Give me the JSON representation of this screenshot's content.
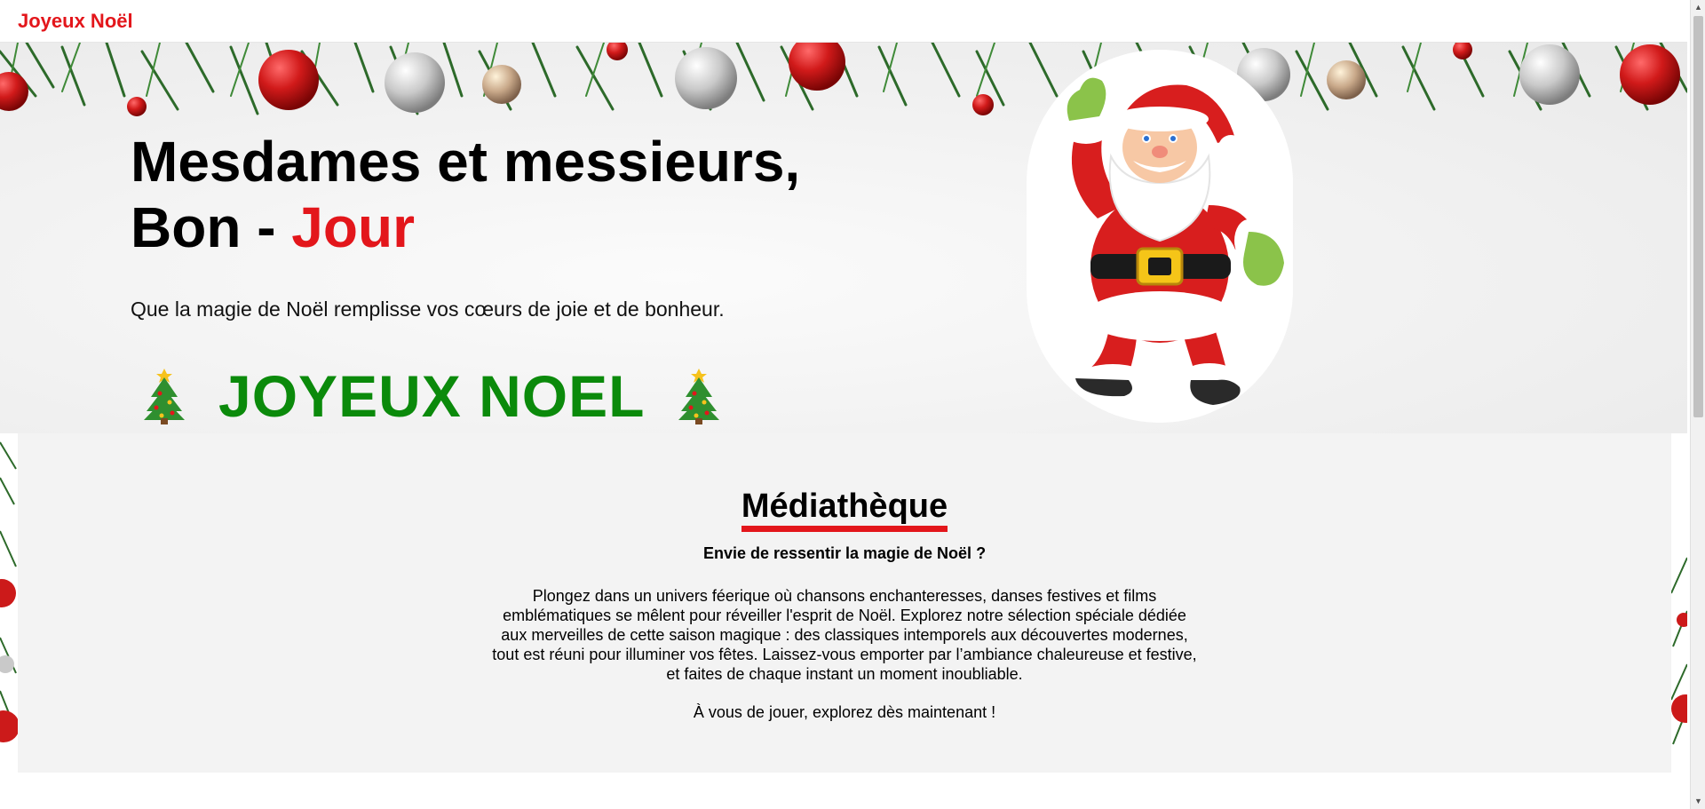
{
  "navbar": {
    "brand": "Joyeux Noël"
  },
  "hero": {
    "title_line1": "Mesdames et messieurs,",
    "title_line2_prefix": "Bon - ",
    "title_line2_accent": "Jour",
    "subtitle": "Que la magie de Noël remplisse vos cœurs de joie et de bonheur.",
    "greeting": "JOYEUX NOEL",
    "greeting_icon": "christmas-tree-icon",
    "image": "santa-claus"
  },
  "media": {
    "title": "Médiathèque",
    "lead": "Envie de ressentir la magie de Noël ?",
    "body": "Plongez dans un univers féerique où chansons enchanteresses, danses festives et films emblématiques se mêlent pour réveiller l'esprit de Noël. Explorez notre sélection spéciale dédiée aux merveilles de cette saison magique : des classiques intemporels aux découvertes modernes, tout est réuni pour illuminer vos fêtes. Laissez-vous emporter par l’ambiance chaleureuse et festive, et faites de chaque instant un moment inoubliable.",
    "cta": "À vous de jouer, explorez dès maintenant !"
  },
  "colors": {
    "accent_red": "#e3161b",
    "christmas_green": "#0b8a0b",
    "section_bg": "#f3f3f3"
  }
}
